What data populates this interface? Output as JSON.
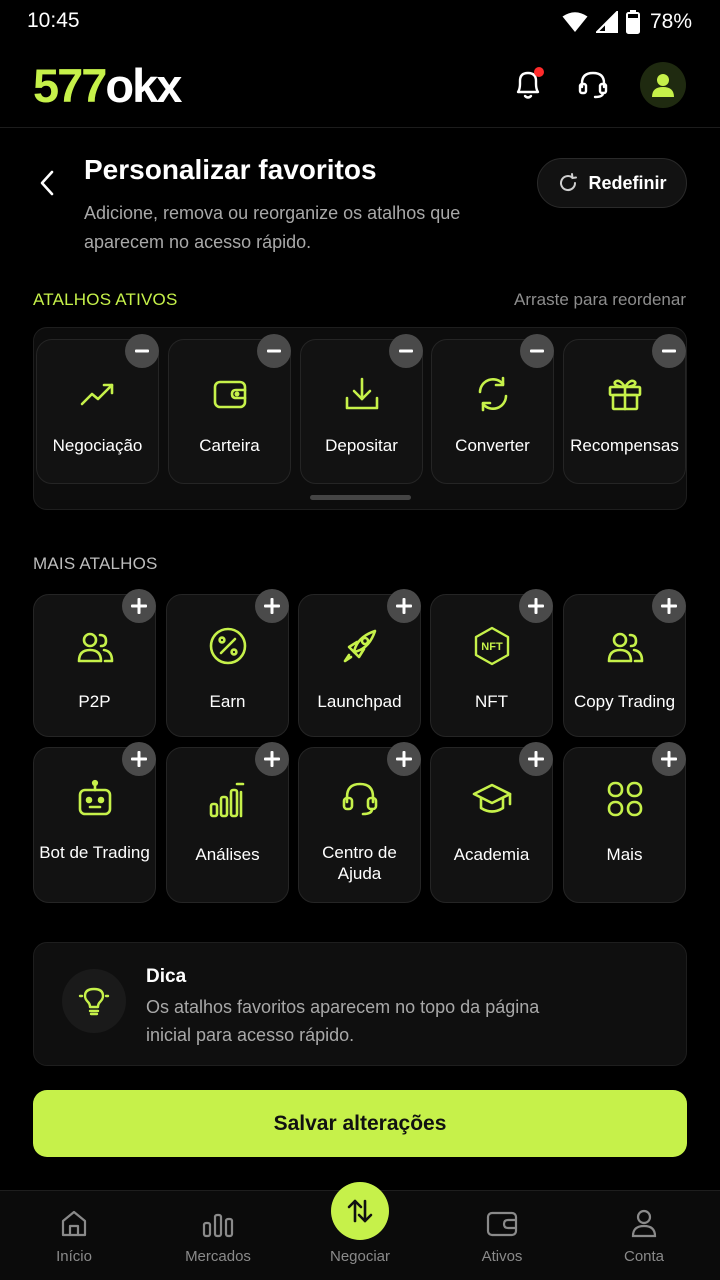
{
  "status_bar": {
    "time": "10:45",
    "battery": "78%"
  },
  "header": {
    "logo_part1": "577",
    "logo_part2": "okx",
    "icons": [
      "bell-icon",
      "headset-icon",
      "user-icon"
    ]
  },
  "page": {
    "title": "Personalizar favoritos",
    "subtitle": "Adicione, remova ou reorganize os atalhos que aparecem no acesso rápido.",
    "reset_label": "Redefinir"
  },
  "active_section": {
    "label": "ATALHOS ATIVOS",
    "hint": "Arraste para reordenar",
    "items": [
      {
        "label": "Negociação",
        "icon": "trending-up-icon"
      },
      {
        "label": "Carteira",
        "icon": "wallet-icon"
      },
      {
        "label": "Depositar",
        "icon": "download-icon"
      },
      {
        "label": "Converter",
        "icon": "refresh-icon"
      },
      {
        "label": "Recompensas",
        "icon": "gift-icon"
      }
    ]
  },
  "more_section": {
    "label": "MAIS ATALHOS",
    "items": [
      {
        "label": "P2P",
        "icon": "users-icon"
      },
      {
        "label": "Earn",
        "icon": "percent-icon"
      },
      {
        "label": "Launchpad",
        "icon": "rocket-icon"
      },
      {
        "label": "NFT",
        "icon": "nft-icon"
      },
      {
        "label": "Copy Trading",
        "icon": "users-icon"
      },
      {
        "label": "Bot de Trading",
        "icon": "bot-icon"
      },
      {
        "label": "Análises",
        "icon": "bar-chart-icon"
      },
      {
        "label": "Centro de Ajuda",
        "icon": "headset-icon"
      },
      {
        "label": "Academia",
        "icon": "graduation-cap-icon"
      },
      {
        "label": "Mais",
        "icon": "grid-icon"
      }
    ]
  },
  "tip": {
    "title": "Dica",
    "text": "Os atalhos favoritos aparecem no topo da página inicial para acesso rápido."
  },
  "save_label": "Salvar alterações",
  "bottom_nav": {
    "items": [
      {
        "label": "Início",
        "icon": "home-icon"
      },
      {
        "label": "Mercados",
        "icon": "bar-chart-icon"
      },
      {
        "label": "Negociar",
        "icon": "swap-vertical-icon"
      },
      {
        "label": "Ativos",
        "icon": "wallet-icon"
      },
      {
        "label": "Conta",
        "icon": "user-icon"
      }
    ]
  },
  "colors": {
    "accent": "#c6f14a",
    "background": "#000000",
    "card": "#121212",
    "notification": "#ff2b2b"
  }
}
